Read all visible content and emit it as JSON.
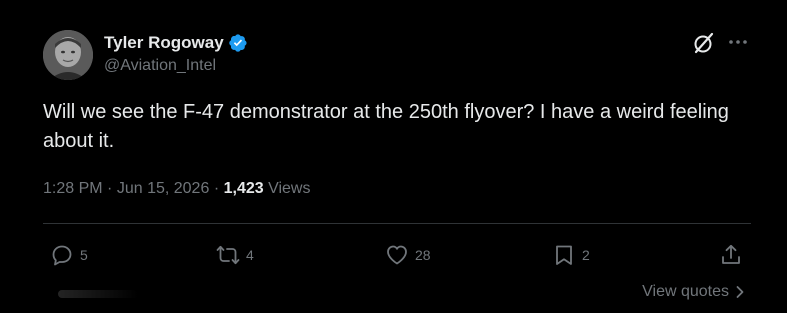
{
  "author": {
    "display_name": "Tyler Rogoway",
    "handle": "@Aviation_Intel",
    "verified": true
  },
  "tweet": {
    "text": "Will we see the F-47 demonstrator at the 250th flyover? I have a weird feeling about it.",
    "time": "1:28 PM",
    "separator": "·",
    "date": "Jun 15, 2026",
    "views_count": "1,423",
    "views_label": "Views"
  },
  "actions": {
    "reply_count": "5",
    "retweet_count": "4",
    "like_count": "28",
    "bookmark_count": "2"
  },
  "footer": {
    "view_quotes_label": "View quotes"
  },
  "colors": {
    "background": "#000000",
    "primary_text": "#e7e9ea",
    "secondary_text": "#71767b",
    "verified_blue": "#1d9bf0",
    "divider": "#2f3336"
  },
  "icons": {
    "verified": "verified-badge-icon",
    "grok": "grok-icon",
    "more": "more-dots-icon",
    "reply": "reply-icon",
    "retweet": "retweet-icon",
    "like": "heart-icon",
    "bookmark": "bookmark-icon",
    "share": "share-icon",
    "chevron": "chevron-right-icon"
  }
}
